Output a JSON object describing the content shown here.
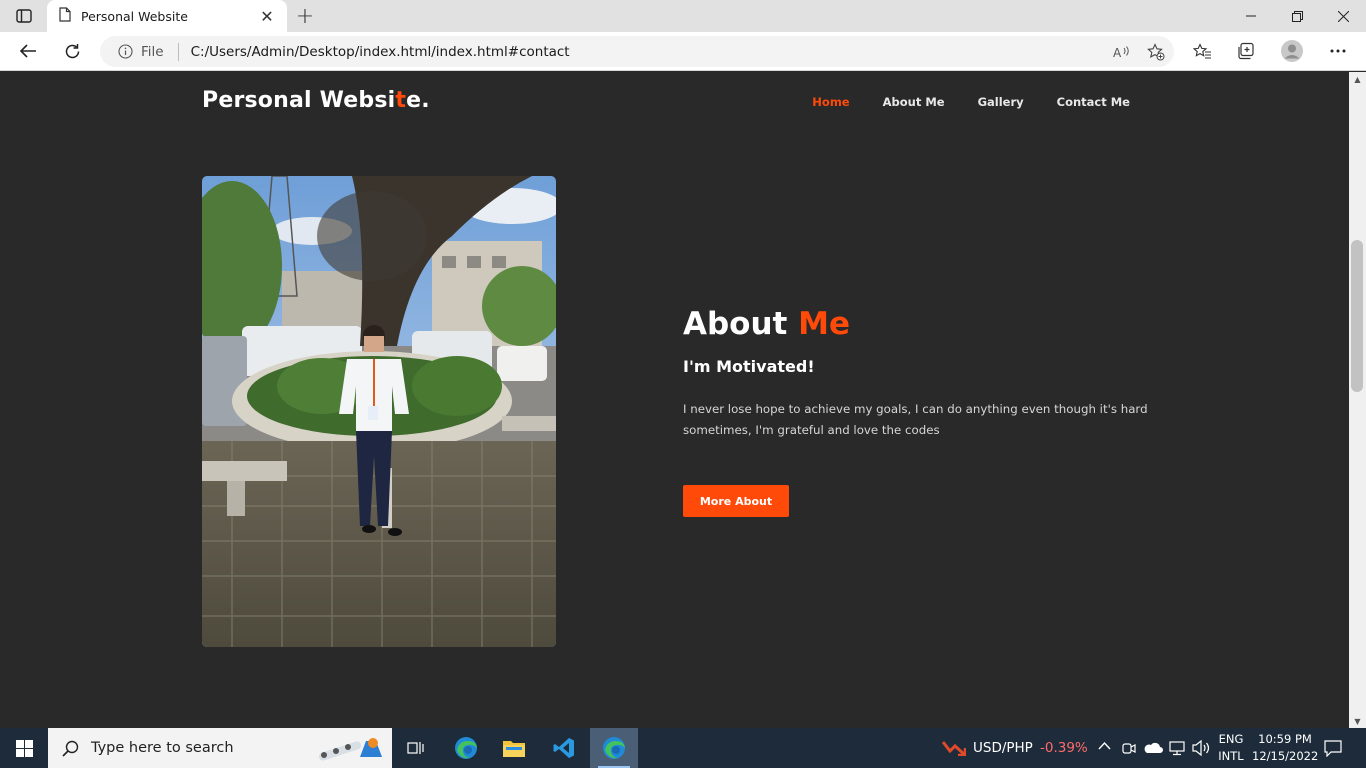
{
  "browser": {
    "tab_title": "Personal Website",
    "address_scheme_label": "File",
    "url": "C:/Users/Admin/Desktop/index.html/index.html#contact"
  },
  "site": {
    "logo_prefix": "Personal Websi",
    "logo_accent": "t",
    "logo_suffix": "e.",
    "nav": [
      {
        "label": "Home",
        "active": true
      },
      {
        "label": "About Me",
        "active": false
      },
      {
        "label": "Gallery",
        "active": false
      },
      {
        "label": "Contact Me",
        "active": false
      }
    ],
    "about": {
      "title_main": "About ",
      "title_accent": "Me",
      "subtitle": "I'm Motivated!",
      "text": "I never lose hope to achieve my goals, I can do anything even though it's hard sometimes, I'm grateful and love the codes",
      "button": "More About"
    }
  },
  "taskbar": {
    "search_placeholder": "Type here to search",
    "ticker_label": "USD/PHP",
    "ticker_value": "-0.39%",
    "lang_top": "ENG",
    "lang_bottom": "INTL",
    "time": "10:59 PM",
    "date": "12/15/2022"
  },
  "colors": {
    "accent": "#ff4a0a",
    "page_bg": "#292929",
    "taskbar_bg": "#1d2b3a",
    "ticker_negative": "#ff6b6b"
  }
}
